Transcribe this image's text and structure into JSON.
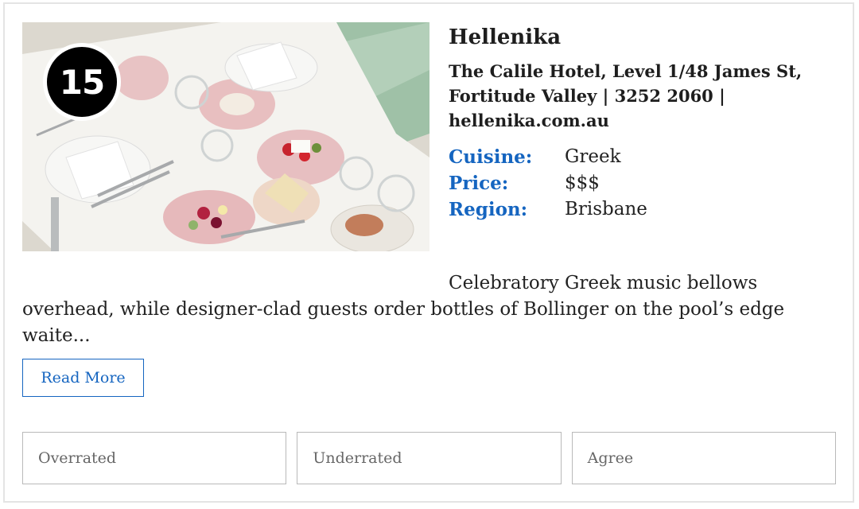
{
  "restaurant": {
    "rank": "15",
    "name": "Hellenika",
    "address": "The Calile Hotel, Level 1/48 James St, Fortitude Valley | 3252 2060 | hellenika.com.au",
    "details": [
      {
        "label": "Cuisine:",
        "value": "Greek"
      },
      {
        "label": "Price:",
        "value": "$$$"
      },
      {
        "label": "Region:",
        "value": "Brisbane"
      }
    ],
    "blurb": "Celebratory Greek music bellows overhead, while designer-clad guests order bottles of Bollinger on the pool’s edge waite...",
    "read_more_label": "Read More"
  },
  "votes": [
    {
      "label": "Overrated"
    },
    {
      "label": "Underrated"
    },
    {
      "label": "Agree"
    }
  ],
  "colors": {
    "accent": "#1565c0",
    "text": "#222222",
    "border": "#b9b9b9"
  }
}
